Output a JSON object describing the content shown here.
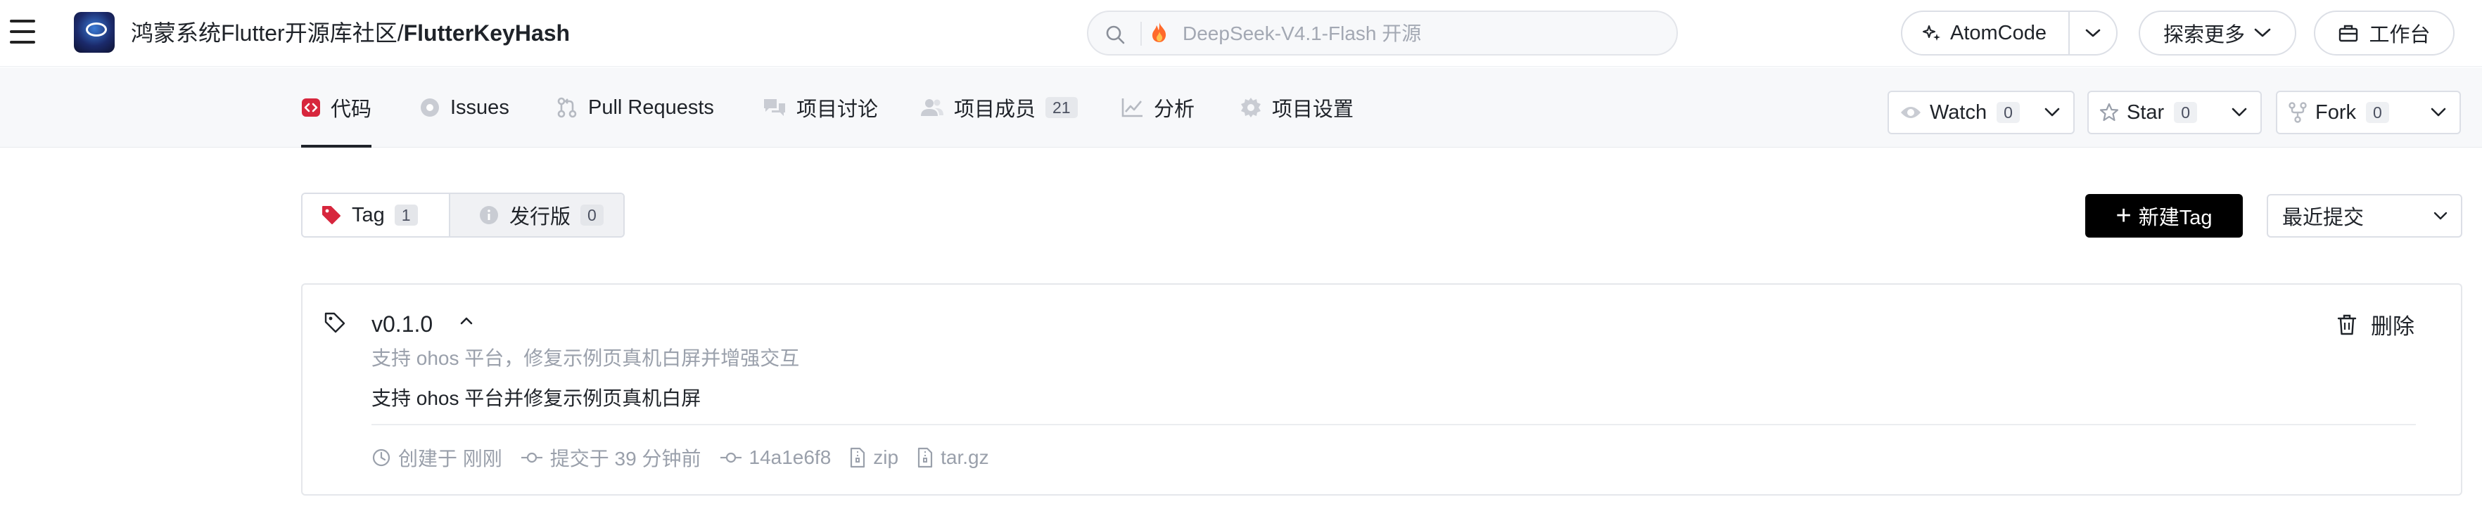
{
  "header": {
    "menu_icon": "hamburger-menu-icon",
    "logo": "repo-logo",
    "owner": "鸿蒙系统Flutter开源库社区",
    "separator": "/",
    "repo": "FlutterKeyHash",
    "search_placeholder": "DeepSeek-V4.1-Flash 开源",
    "search_icon": "search-icon",
    "trending_icon": "fire-icon",
    "atomcode_label": "AtomCode",
    "explore_label": "探索更多",
    "workbench_label": "工作台"
  },
  "tabs": [
    {
      "label": "代码",
      "icon": "code-icon",
      "active": true
    },
    {
      "label": "Issues",
      "icon": "issues-icon"
    },
    {
      "label": "Pull Requests",
      "icon": "pull-request-icon"
    },
    {
      "label": "项目讨论",
      "icon": "discussion-icon"
    },
    {
      "label": "项目成员",
      "icon": "members-icon",
      "count": "21"
    },
    {
      "label": "分析",
      "icon": "analytics-icon"
    },
    {
      "label": "项目设置",
      "icon": "settings-icon"
    }
  ],
  "social": {
    "watch": {
      "label": "Watch",
      "count": "0"
    },
    "star": {
      "label": "Star",
      "count": "0"
    },
    "fork": {
      "label": "Fork",
      "count": "0"
    }
  },
  "toolbar": {
    "tag_label": "Tag",
    "tag_count": "1",
    "release_label": "发行版",
    "release_count": "0",
    "new_tag_label": "新建Tag",
    "sort_label": "最近提交"
  },
  "tag_card": {
    "name": "v0.1.0",
    "subtitle": "支持 ohos 平台，修复示例页真机白屏并增强交互",
    "description": "支持 ohos 平台并修复示例页真机白屏",
    "delete_label": "删除",
    "created_label": "创建于 刚刚",
    "committed_label": "提交于 39 分钟前",
    "commit_hash": "14a1e6f8",
    "zip_label": "zip",
    "targz_label": "tar.gz"
  },
  "colors": {
    "accent_red": "#d7263d",
    "primary_button": "#000000",
    "muted_text": "#9aa0ab",
    "subnav_bg": "#f7f8fa"
  }
}
